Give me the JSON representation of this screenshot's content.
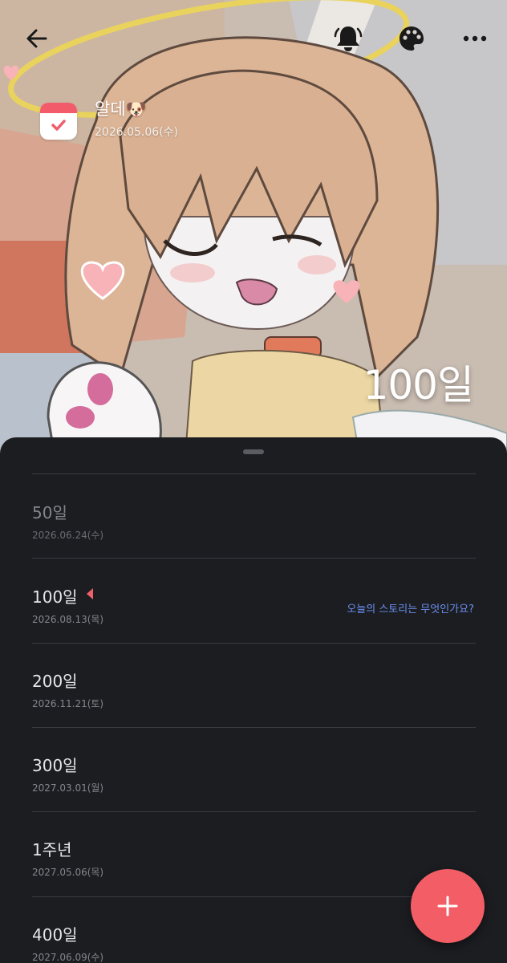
{
  "header": {
    "event_title": "알데🐶",
    "event_date": "2026.05.06(수)",
    "day_count": "100일"
  },
  "icons": {
    "back": "arrow-left-icon",
    "notification": "bell-icon",
    "theme": "palette-icon",
    "more": "more-horizontal-icon",
    "calendar": "calendar-check-icon",
    "add": "plus-icon"
  },
  "colors": {
    "accent": "#f35e66",
    "sheet_background": "#1c1d21",
    "prompt_link": "#6a8ff0",
    "today_marker": "#f0606a"
  },
  "milestones": [
    {
      "label": "50일",
      "date": "2026.06.24(수)",
      "state": "past"
    },
    {
      "label": "100일",
      "date": "2026.08.13(목)",
      "state": "current",
      "prompt": "오늘의 스토리는 무엇인가요?"
    },
    {
      "label": "200일",
      "date": "2026.11.21(토)",
      "state": "upcoming"
    },
    {
      "label": "300일",
      "date": "2027.03.01(월)",
      "state": "upcoming"
    },
    {
      "label": "1주년",
      "date": "2027.05.06(목)",
      "state": "upcoming"
    },
    {
      "label": "400일",
      "date": "2027.06.09(수)",
      "state": "upcoming"
    }
  ]
}
